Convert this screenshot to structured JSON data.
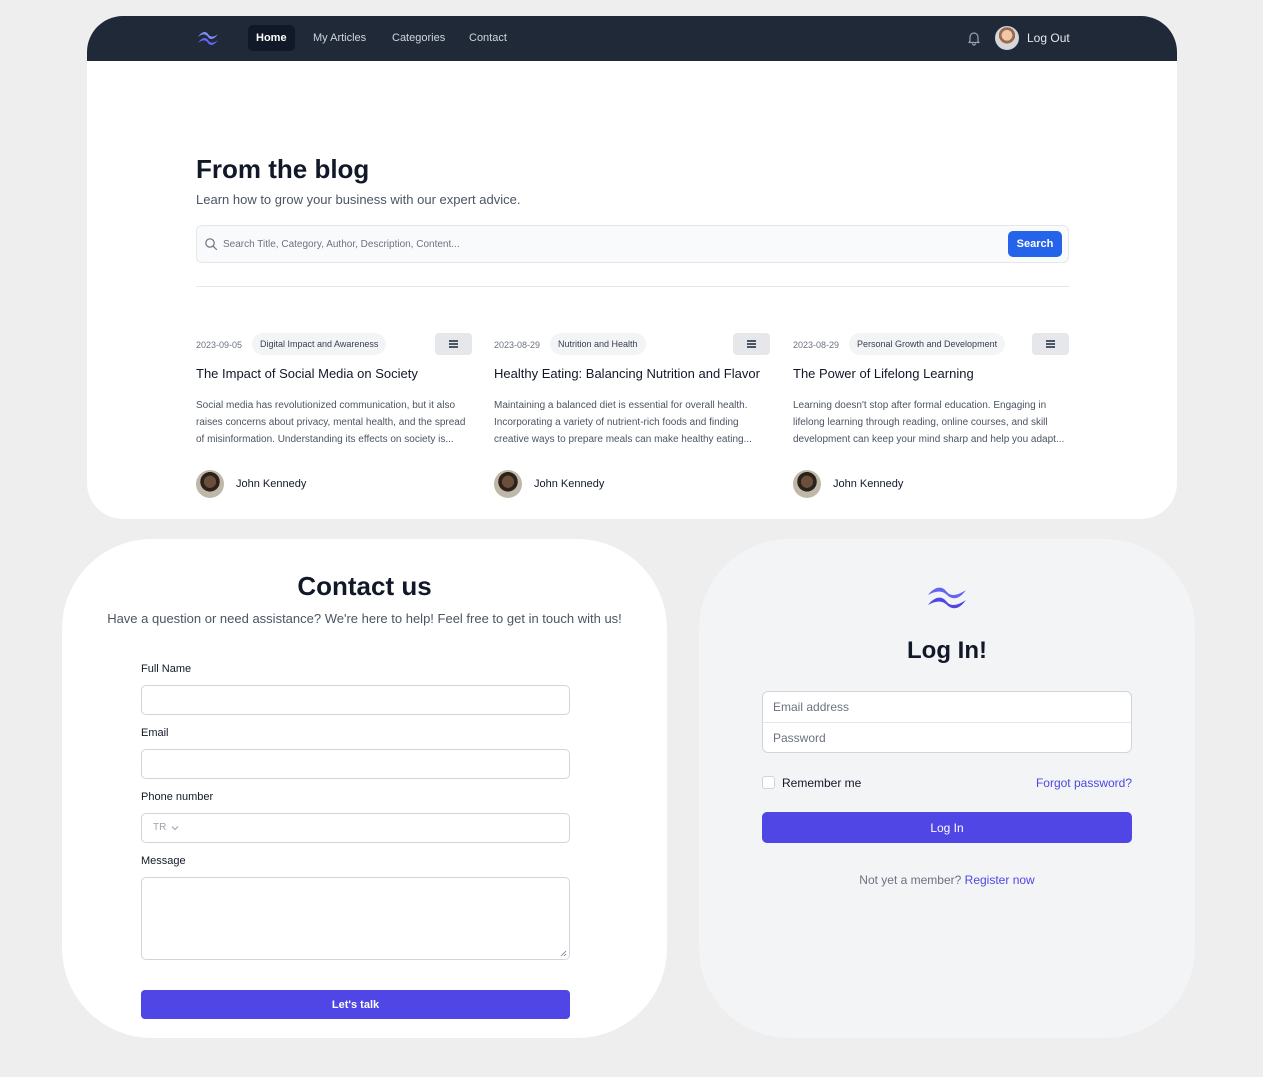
{
  "nav": {
    "items": [
      {
        "label": "Home",
        "active": true
      },
      {
        "label": "My Articles",
        "active": false
      },
      {
        "label": "Categories",
        "active": false
      },
      {
        "label": "Contact",
        "active": false
      }
    ],
    "logout_label": "Log Out"
  },
  "blog": {
    "title": "From the blog",
    "subtitle": "Learn how to grow your business with our expert advice.",
    "search": {
      "placeholder": "Search Title, Category, Author, Description, Content...",
      "button_label": "Search"
    },
    "articles": [
      {
        "date": "2023-09-05",
        "category": "Digital Impact and Awareness",
        "title": "The Impact of Social Media on Society",
        "description": "Social media has revolutionized communication, but it also raises concerns about privacy, mental health, and the spread of misinformation. Understanding its effects on society is...",
        "author": "John Kennedy"
      },
      {
        "date": "2023-08-29",
        "category": "Nutrition and Health",
        "title": "Healthy Eating: Balancing Nutrition and Flavor",
        "description": "Maintaining a balanced diet is essential for overall health. Incorporating a variety of nutrient-rich foods and finding creative ways to prepare meals can make healthy eating...",
        "author": "John Kennedy"
      },
      {
        "date": "2023-08-29",
        "category": "Personal Growth and Development",
        "title": "The Power of Lifelong Learning",
        "description": "Learning doesn't stop after formal education. Engaging in lifelong learning through reading, online courses, and skill development can keep your mind sharp and help you adapt...",
        "author": "John Kennedy"
      }
    ]
  },
  "contact": {
    "title": "Contact us",
    "subtitle": "Have a question or need assistance? We're here to help! Feel free to get in touch with us!",
    "full_name_label": "Full Name",
    "email_label": "Email",
    "phone_label": "Phone number",
    "phone_country_code": "TR",
    "message_label": "Message",
    "submit_label": "Let's talk"
  },
  "login": {
    "title": "Log In!",
    "email_placeholder": "Email address",
    "password_placeholder": "Password",
    "remember_label": "Remember me",
    "forgot_label": "Forgot password?",
    "submit_label": "Log In",
    "register_prompt": "Not yet a member?",
    "register_link": "Register now"
  },
  "colors": {
    "nav_bg": "#1f2937",
    "primary_blue": "#2563eb",
    "primary_indigo": "#4f46e5",
    "page_bg": "#eeeeee"
  }
}
